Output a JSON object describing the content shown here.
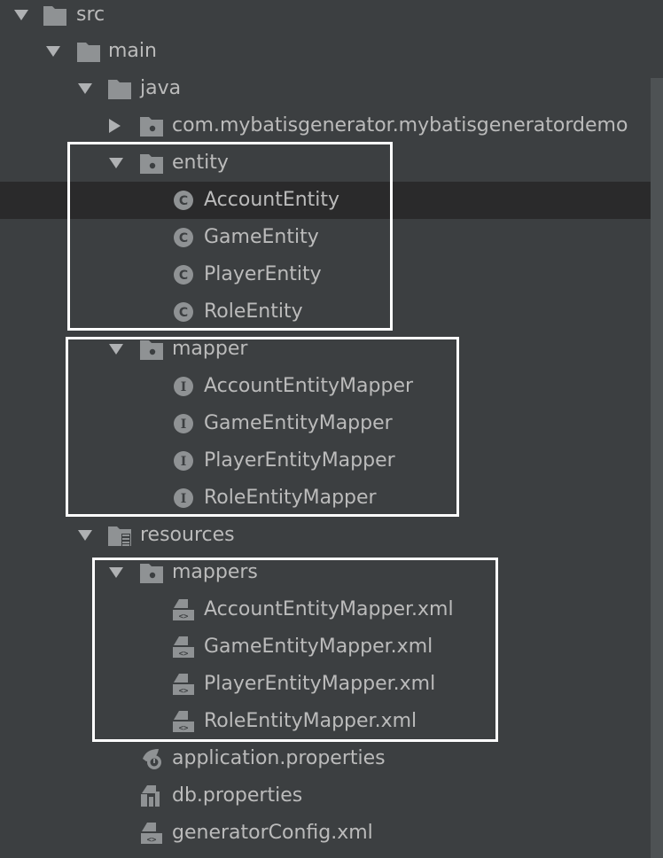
{
  "tree": {
    "src": {
      "label": "src",
      "icon": "folder-icon",
      "expanded": true
    },
    "main": {
      "label": "main",
      "icon": "folder-icon",
      "expanded": true
    },
    "java": {
      "label": "java",
      "icon": "source-folder-icon",
      "expanded": true
    },
    "demo_package": {
      "label": "com.mybatisgenerator.mybatisgeneratordemo",
      "icon": "package-icon",
      "expanded": false
    },
    "entity": {
      "label": "entity",
      "icon": "package-icon",
      "expanded": true,
      "items": [
        {
          "label": "AccountEntity",
          "icon": "class-icon",
          "selected": true
        },
        {
          "label": "GameEntity",
          "icon": "class-icon"
        },
        {
          "label": "PlayerEntity",
          "icon": "class-icon"
        },
        {
          "label": "RoleEntity",
          "icon": "class-icon"
        }
      ]
    },
    "mapper": {
      "label": "mapper",
      "icon": "package-icon",
      "expanded": true,
      "items": [
        {
          "label": "AccountEntityMapper",
          "icon": "interface-icon"
        },
        {
          "label": "GameEntityMapper",
          "icon": "interface-icon"
        },
        {
          "label": "PlayerEntityMapper",
          "icon": "interface-icon"
        },
        {
          "label": "RoleEntityMapper",
          "icon": "interface-icon"
        }
      ]
    },
    "resources": {
      "label": "resources",
      "icon": "resources-folder-icon",
      "expanded": true
    },
    "mappers": {
      "label": "mappers",
      "icon": "package-icon",
      "expanded": true,
      "items": [
        {
          "label": "AccountEntityMapper.xml",
          "icon": "xml-file-icon"
        },
        {
          "label": "GameEntityMapper.xml",
          "icon": "xml-file-icon"
        },
        {
          "label": "PlayerEntityMapper.xml",
          "icon": "xml-file-icon"
        },
        {
          "label": "RoleEntityMapper.xml",
          "icon": "xml-file-icon"
        }
      ]
    },
    "files": [
      {
        "label": "application.properties",
        "icon": "spring-properties-icon"
      },
      {
        "label": "db.properties",
        "icon": "properties-file-icon"
      },
      {
        "label": "generatorConfig.xml",
        "icon": "xml-file-icon"
      }
    ]
  },
  "colors": {
    "background": "#3c3f41",
    "selection": "#2a2a2b",
    "text": "#bbbbbb",
    "icon_gray": "#8f9294",
    "arrow": "#afb1b3",
    "highlight_border": "#ffffff"
  }
}
